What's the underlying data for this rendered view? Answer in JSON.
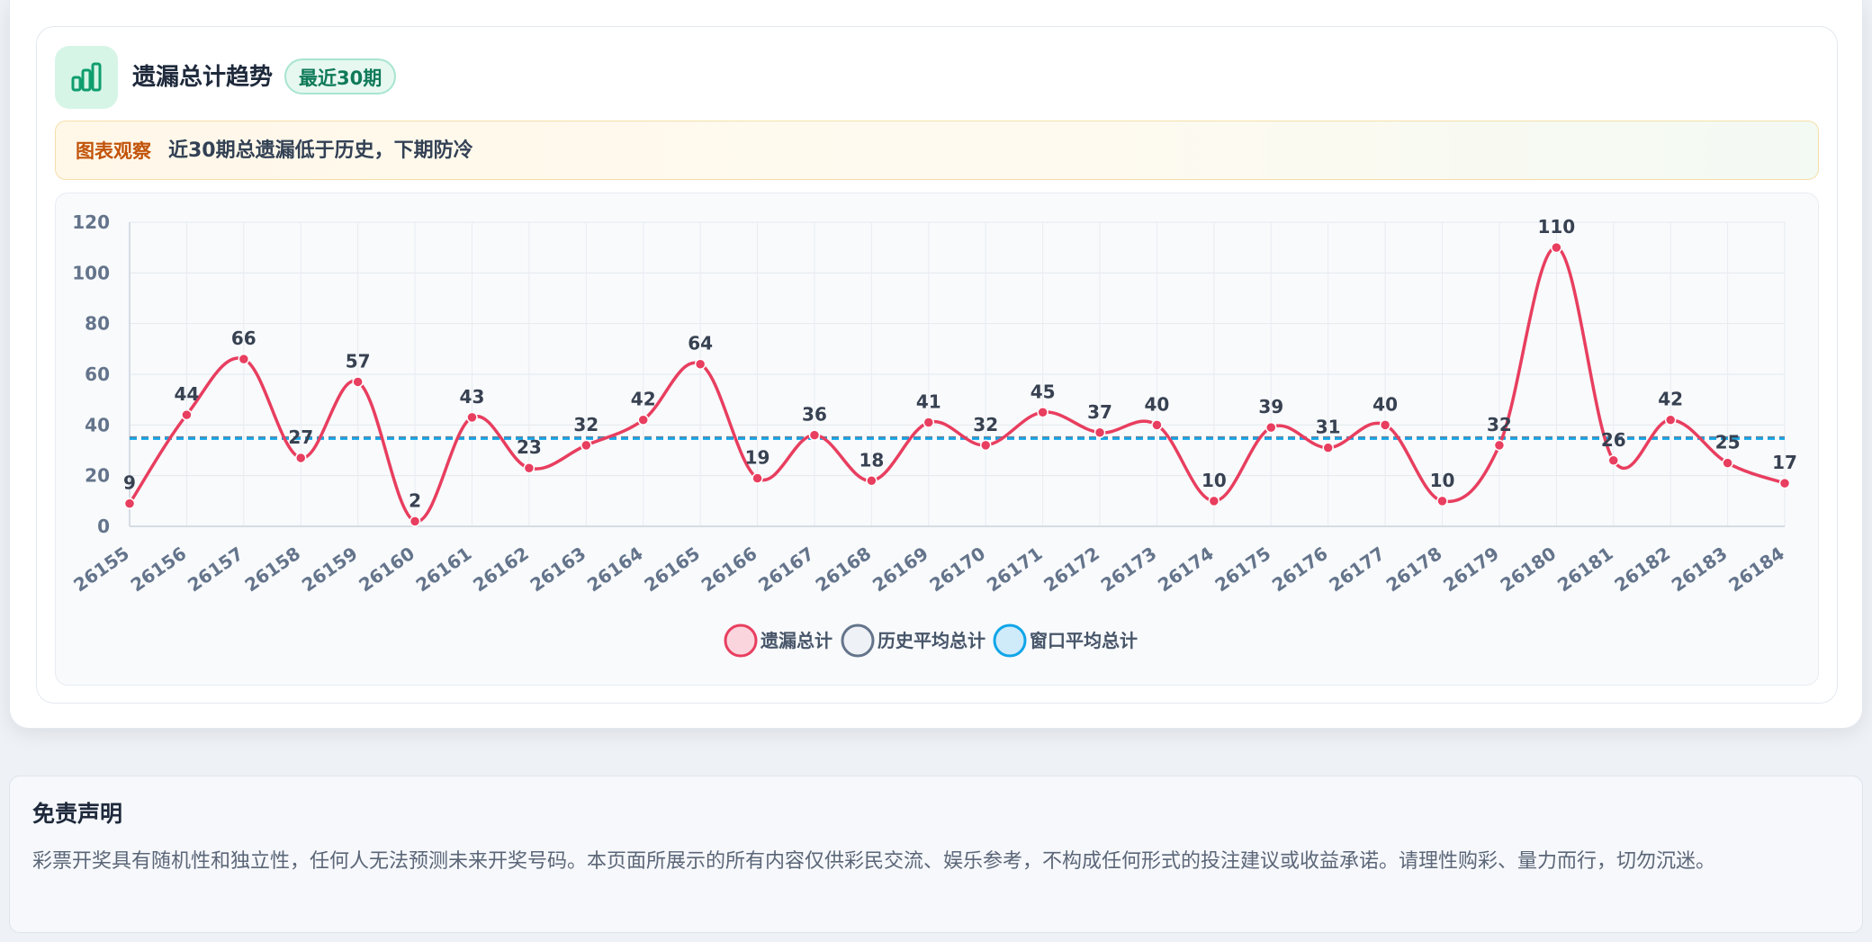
{
  "card": {
    "title": "遗漏总计趋势",
    "badge": "最近30期",
    "icon": "bar-chart-icon",
    "accent": "#0f9d6e"
  },
  "notice": {
    "label": "图表观察",
    "text": "近30期总遗漏低于历史，下期防冷"
  },
  "disclaimer": {
    "title": "免责声明",
    "text": "彩票开奖具有随机性和独立性，任何人无法预测未来开奖号码。本页面所展示的所有内容仅供彩民交流、娱乐参考，不构成任何形式的投注建议或收益承诺。请理性购彩、量力而行，切勿沉迷。"
  },
  "chart_data": {
    "type": "line",
    "x": [
      "26155",
      "26156",
      "26157",
      "26158",
      "26159",
      "26160",
      "26161",
      "26162",
      "26163",
      "26164",
      "26165",
      "26166",
      "26167",
      "26168",
      "26169",
      "26170",
      "26171",
      "26172",
      "26173",
      "26174",
      "26175",
      "26176",
      "26177",
      "26178",
      "26179",
      "26180",
      "26181",
      "26182",
      "26183",
      "26184"
    ],
    "series": [
      {
        "name": "遗漏总计",
        "values": [
          9,
          44,
          66,
          27,
          57,
          2,
          43,
          23,
          32,
          42,
          64,
          19,
          36,
          18,
          41,
          32,
          45,
          37,
          40,
          10,
          39,
          31,
          40,
          10,
          32,
          110,
          26,
          42,
          25,
          17
        ],
        "color": "#e83e5f",
        "style": "smooth line with data labels"
      },
      {
        "name": "历史平均总计",
        "values": [
          35,
          35,
          35,
          35,
          35,
          35,
          35,
          35,
          35,
          35,
          35,
          35,
          35,
          35,
          35,
          35,
          35,
          35,
          35,
          35,
          35,
          35,
          35,
          35,
          35,
          35,
          35,
          35,
          35,
          35
        ],
        "color": "#64748b",
        "style": "dashed"
      },
      {
        "name": "窗口平均总计",
        "values": [
          34.6,
          34.6,
          34.6,
          34.6,
          34.6,
          34.6,
          34.6,
          34.6,
          34.6,
          34.6,
          34.6,
          34.6,
          34.6,
          34.6,
          34.6,
          34.6,
          34.6,
          34.6,
          34.6,
          34.6,
          34.6,
          34.6,
          34.6,
          34.6,
          34.6,
          34.6,
          34.6,
          34.6,
          34.6,
          34.6
        ],
        "color": "#0ea5e9",
        "style": "dashed"
      }
    ],
    "yticks": [
      0,
      20,
      40,
      60,
      80,
      100,
      120
    ],
    "ylim": [
      0,
      120
    ],
    "grid": true,
    "legend": "bottom-center"
  }
}
